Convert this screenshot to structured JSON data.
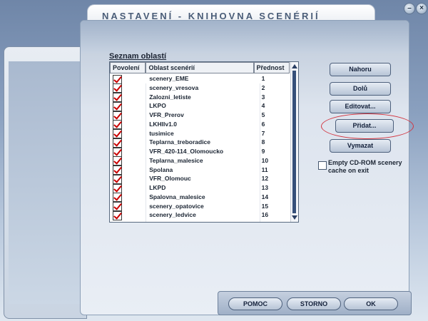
{
  "window": {
    "title": "NASTAVENÍ - KNIHOVNA SCENÉRIÍ",
    "controls": [
      "–",
      "×"
    ]
  },
  "list": {
    "label": "Seznam oblastí",
    "columns": [
      "Povolení",
      "Oblast scenérií",
      "Přednost"
    ],
    "rows": [
      {
        "name": "scenery_EME",
        "priority": "1"
      },
      {
        "name": "scenery_vresova",
        "priority": "2"
      },
      {
        "name": "Zalozni_letiste",
        "priority": "3"
      },
      {
        "name": "LKPO",
        "priority": "4"
      },
      {
        "name": "VFR_Prerov",
        "priority": "5"
      },
      {
        "name": "LKHIlv1.0",
        "priority": "6"
      },
      {
        "name": "tusimice",
        "priority": "7"
      },
      {
        "name": "Teplarna_treboradice",
        "priority": "8"
      },
      {
        "name": "VFR_420-114_Olomoucko",
        "priority": "9"
      },
      {
        "name": "Teplarna_malesice",
        "priority": "10"
      },
      {
        "name": "Spolana",
        "priority": "11"
      },
      {
        "name": "VFR_Olomouc",
        "priority": "12"
      },
      {
        "name": "LKPD",
        "priority": "13"
      },
      {
        "name": "Spalovna_malesice",
        "priority": "14"
      },
      {
        "name": "scenery_opatovice",
        "priority": "15"
      },
      {
        "name": "scenery_ledvice",
        "priority": "16"
      }
    ]
  },
  "buttons": {
    "up": "Nahoru",
    "down": "Dolů",
    "edit": "Editovat...",
    "add": "Přidat...",
    "delete": "Vymazat"
  },
  "cd_cache": {
    "label": "Empty CD-ROM scenery cache on exit",
    "checked": false
  },
  "footer": {
    "help": "POMOC",
    "cancel": "STORNO",
    "ok": "OK"
  },
  "colors": {
    "highlight_ellipse": "#d2343f",
    "check_mark": "#c80000"
  }
}
